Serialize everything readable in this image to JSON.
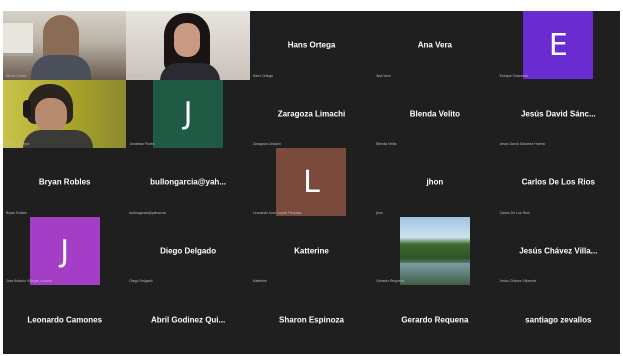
{
  "colors": {
    "background": "#1f1f1f",
    "avatar_purple": "#6a2bd1",
    "avatar_green": "#1f5a45",
    "avatar_brown": "#7a4a3c",
    "avatar_magenta": "#a43ec7"
  },
  "tiles": [
    {
      "name": "",
      "label": "Alexis Carlos",
      "kind": "camera"
    },
    {
      "name": "",
      "label": "Ana Gomez",
      "kind": "camera"
    },
    {
      "name": "Hans Ortega",
      "label": "Hans Ortega",
      "kind": "name"
    },
    {
      "name": "Ana Vera",
      "label": "Ana Vera",
      "kind": "name"
    },
    {
      "avatar": "E",
      "label": "Enrique Chavarria",
      "kind": "avatar"
    },
    {
      "name": "",
      "label": "Sergio Pereyra",
      "kind": "camera"
    },
    {
      "avatar": "J",
      "label": "Jonathan Flores",
      "kind": "avatar"
    },
    {
      "name": "Zaragoza Limachi",
      "label": "Zaragoza Limachi",
      "kind": "name"
    },
    {
      "name": "Blenda Velito",
      "label": "Blenda Velito",
      "kind": "name"
    },
    {
      "name": "Jesús David Sánc...",
      "label": "Jesús David Sánchez Huerta",
      "kind": "name"
    },
    {
      "name": "Bryan Robles",
      "label": "Bryan Robles",
      "kind": "name"
    },
    {
      "name": "bullongarcia@yah...",
      "label": "bullongarcia@yahoo.es",
      "kind": "name"
    },
    {
      "avatar": "L",
      "label": "Leonardo Jose Loyola Pedraza",
      "kind": "avatar"
    },
    {
      "name": "jhon",
      "label": "jhon",
      "kind": "name"
    },
    {
      "name": "Carlos De Los Rios",
      "label": "Carlos De Los Rios",
      "kind": "name"
    },
    {
      "avatar": "J",
      "label": "Jose Antonio Villegas Lucana",
      "kind": "avatar"
    },
    {
      "name": "Diego Delgado",
      "label": "Diego Delgado",
      "kind": "name"
    },
    {
      "name": "Katterine",
      "label": "Katterine",
      "kind": "name"
    },
    {
      "name": "",
      "label": "Gerardo Requena",
      "kind": "landscape"
    },
    {
      "name": "Jesús Chávez Villa...",
      "label": "Jesús Chávez Villarreal",
      "kind": "name"
    },
    {
      "name": "Leonardo Camones",
      "label": "",
      "kind": "name"
    },
    {
      "name": "Abril Godinez Qui...",
      "label": "",
      "kind": "name"
    },
    {
      "name": "Sharon Espinoza",
      "label": "",
      "kind": "name"
    },
    {
      "name": "Gerardo Requena",
      "label": "",
      "kind": "name"
    },
    {
      "name": "santiago zevallos",
      "label": "",
      "kind": "name"
    }
  ]
}
